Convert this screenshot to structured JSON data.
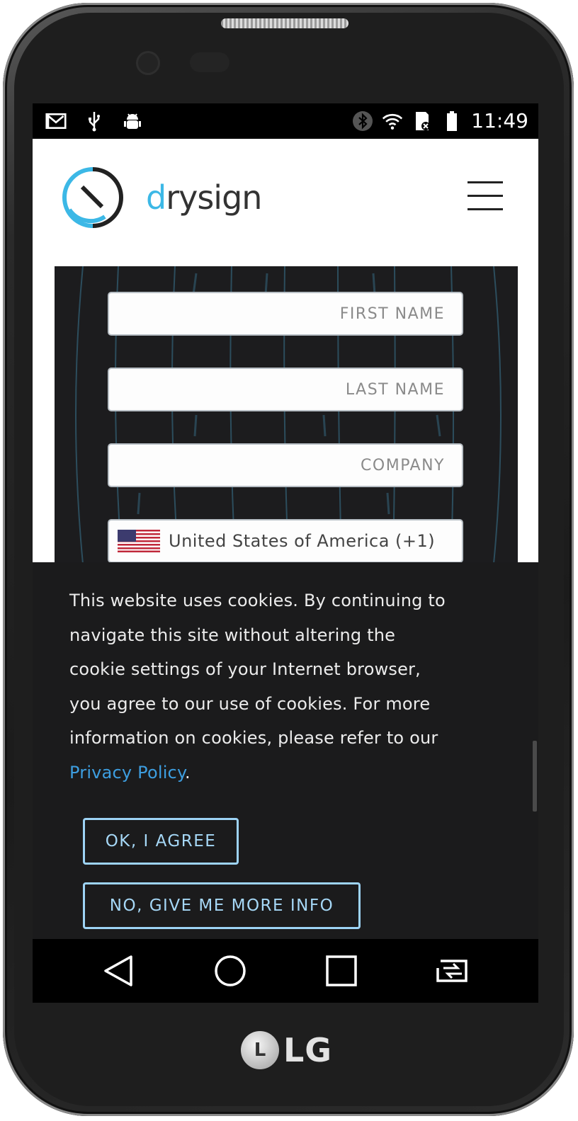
{
  "device": {
    "brand_label": "LG",
    "brand_mark": "L"
  },
  "status_bar": {
    "time": "11:49",
    "left_icons": [
      "gmail-icon",
      "usb-icon",
      "android-debug-icon"
    ],
    "right_icons": [
      "bluetooth-icon",
      "wifi-icon",
      "sd-card-icon",
      "battery-icon"
    ]
  },
  "header": {
    "logo_text_accent": "d",
    "logo_text_rest": "rysign",
    "menu_icon": "hamburger-icon"
  },
  "form": {
    "first_name_placeholder": "FIRST NAME",
    "last_name_placeholder": "LAST NAME",
    "company_placeholder": "COMPANY",
    "country_value": "United States of America (+1)",
    "country_flag": "us-flag-icon"
  },
  "cookie_banner": {
    "text_lines": [
      "This website uses cookies. By continuing to",
      "navigate this site without altering the",
      "cookie settings of your Internet browser,",
      "you agree to our use of cookies. For more",
      "information on cookies, please refer to our"
    ],
    "privacy_link": "Privacy Policy",
    "privacy_suffix": ".",
    "agree_button": "OK, I AGREE",
    "more_info_button": "NO, GIVE ME MORE INFO"
  },
  "nav_bar": {
    "icons": [
      "back-icon",
      "home-icon",
      "recents-icon",
      "switch-app-icon"
    ]
  },
  "colors": {
    "accent": "#3cb8e6",
    "link": "#3d9ee0",
    "button_border": "#9dd3f5",
    "banner_bg": "#1b1b1c"
  }
}
